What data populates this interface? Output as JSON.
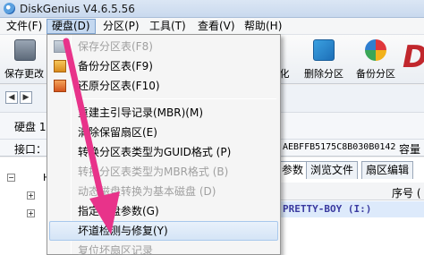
{
  "titlebar": {
    "title": "DiskGenius V4.6.5.56"
  },
  "menu": [
    {
      "label": "文件(F)"
    },
    {
      "label": "硬盘(D)"
    },
    {
      "label": "分区(P)"
    },
    {
      "label": "工具(T)"
    },
    {
      "label": "查看(V)"
    },
    {
      "label": "帮助(H)"
    }
  ],
  "toolbar": {
    "save_label": "保存更改",
    "format_label": "化",
    "delete_label": "删除分区",
    "backup_label": "备份分区"
  },
  "disk_info": {
    "disk_label": "硬盘 1",
    "interface_label": "接口：U",
    "serial": "AEBFFB5175C8B030B0142",
    "capacity_label": "容量"
  },
  "tree": {
    "root_label": "H"
  },
  "right_panel": {
    "tabs": [
      "参数",
      "浏览文件",
      "扇区编辑"
    ],
    "column_header": "序号 (",
    "selected_row": "PRETTY-BOY (I:)"
  },
  "dropdown": {
    "items": [
      {
        "label": "保存分区表(F8)",
        "enabled": false,
        "icon": "save-icon"
      },
      {
        "label": "备份分区表(F9)",
        "enabled": true,
        "icon": "backup-icon"
      },
      {
        "label": "还原分区表(F10)",
        "enabled": true,
        "icon": "restore-icon"
      },
      {
        "label": "重建主引导记录(MBR)(M)",
        "enabled": true
      },
      {
        "label": "清除保留扇区(E)",
        "enabled": true
      },
      {
        "label": "转换分区表类型为GUID格式 (P)",
        "enabled": true
      },
      {
        "label": "转换分区表类型为MBR格式 (B)",
        "enabled": false
      },
      {
        "label": "动态磁盘转换为基本磁盘 (D)",
        "enabled": false
      },
      {
        "label": "指定硬盘参数(G)",
        "enabled": true
      },
      {
        "label": "坏道检测与修复(Y)",
        "enabled": true,
        "highlighted": true
      },
      {
        "label": "复位坏扇区记录",
        "enabled": false
      }
    ]
  },
  "colors": {
    "annotation_arrow": "#e8338a",
    "menu_highlight": "#d5e4f6",
    "brand_red": "#c1272d"
  }
}
